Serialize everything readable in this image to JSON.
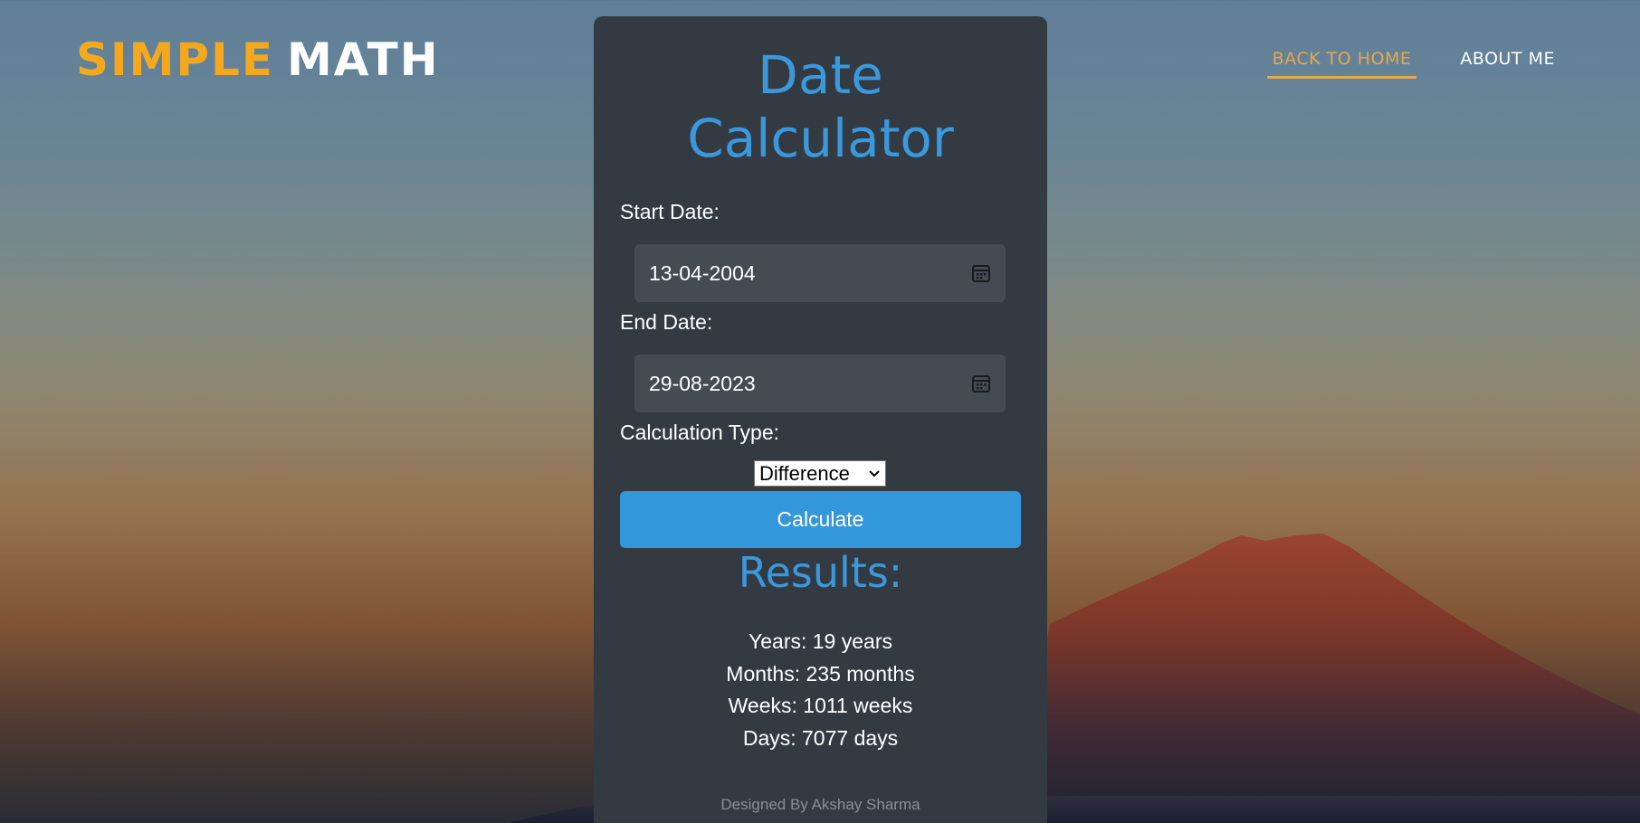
{
  "logo": {
    "part1": "SIMPLE",
    "part2": "MATH"
  },
  "nav": {
    "items": [
      {
        "label": "BACK TO HOME",
        "active": true
      },
      {
        "label": "ABOUT ME",
        "active": false
      }
    ]
  },
  "calculator": {
    "title_line1": "Date",
    "title_line2": "Calculator",
    "start_label": "Start Date:",
    "start_value": "13-04-2004",
    "end_label": "End Date:",
    "end_value": "29-08-2023",
    "type_label": "Calculation Type:",
    "type_value": "Difference",
    "button_label": "Calculate"
  },
  "results": {
    "title": "Results:",
    "lines": [
      "Years: 19 years",
      "Months: 235 months",
      "Weeks: 1011 weeks",
      "Days: 7077 days"
    ]
  },
  "credit": "Designed By Akshay Sharma",
  "colors": {
    "accent_blue": "#3398db",
    "logo_orange": "#f3a81e",
    "card_bg": "#343a42",
    "input_bg": "#454b53",
    "nav_active": "#e5a94b"
  },
  "icons": [
    "calendar-icon",
    "chevron-down-icon"
  ]
}
